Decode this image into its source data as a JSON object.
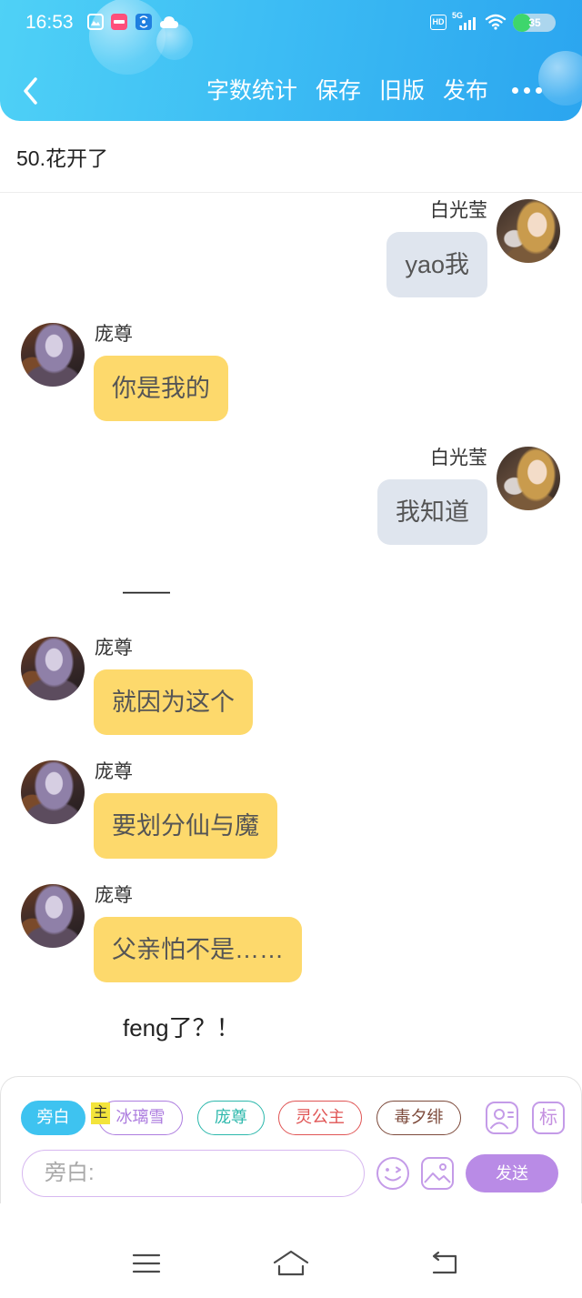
{
  "status_bar": {
    "time": "16:53",
    "hd_label": "HD",
    "network_label": "5G",
    "battery_level": "35",
    "icons": [
      "gallery-notification-icon",
      "app-notification-icon",
      "hotspot-icon",
      "cloud-icon",
      "signal-icon",
      "wifi-icon",
      "battery-icon"
    ]
  },
  "header": {
    "back_icon": "chevron-left-icon",
    "actions": [
      "字数统计",
      "保存",
      "旧版",
      "发布"
    ],
    "more_icon": "more-dots-icon"
  },
  "chapter": {
    "title": "50.花开了"
  },
  "messages": [
    {
      "speaker": "白光莹",
      "text": "yao我",
      "outgoing": true
    },
    {
      "speaker": "庞尊",
      "text": "你是我的",
      "outgoing": false
    },
    {
      "speaker": "白光莹",
      "text": "我知道",
      "outgoing": true
    },
    {
      "narration": "——"
    },
    {
      "speaker": "庞尊",
      "text": "就因为这个",
      "outgoing": false
    },
    {
      "speaker": "庞尊",
      "text": "要划分仙与魔",
      "outgoing": false
    },
    {
      "speaker": "庞尊",
      "text": "父亲怕不是……",
      "outgoing": false
    },
    {
      "narration": "feng了？！"
    }
  ],
  "composer": {
    "roles": [
      {
        "label": "旁白",
        "active": true,
        "color": "#3ec3f0"
      },
      {
        "label": "冰璃雪",
        "active": false,
        "color": "#ad7ddf"
      },
      {
        "label": "庞尊",
        "active": false,
        "color": "#2db8ac"
      },
      {
        "label": "灵公主",
        "active": false,
        "color": "#e05555"
      },
      {
        "label": "毒夕绯",
        "active": false,
        "color": "#7d4a3b"
      }
    ],
    "main_tag": "主",
    "role_manage_icon": "person-card-icon",
    "mark_label": "标",
    "input_placeholder": "旁白:",
    "emoji_icon": "smiley-icon",
    "image_icon": "image-icon",
    "send_label": "发送"
  },
  "system_nav": {
    "icons": [
      "menu-icon",
      "home-icon",
      "back-icon"
    ]
  },
  "colors": {
    "header_gradient_start": "#4fd1f6",
    "header_gradient_end": "#2ba5ef",
    "incoming_bubble": "#fdd96c",
    "outgoing_bubble": "#dfe5ee",
    "accent_purple": "#b98be6"
  }
}
